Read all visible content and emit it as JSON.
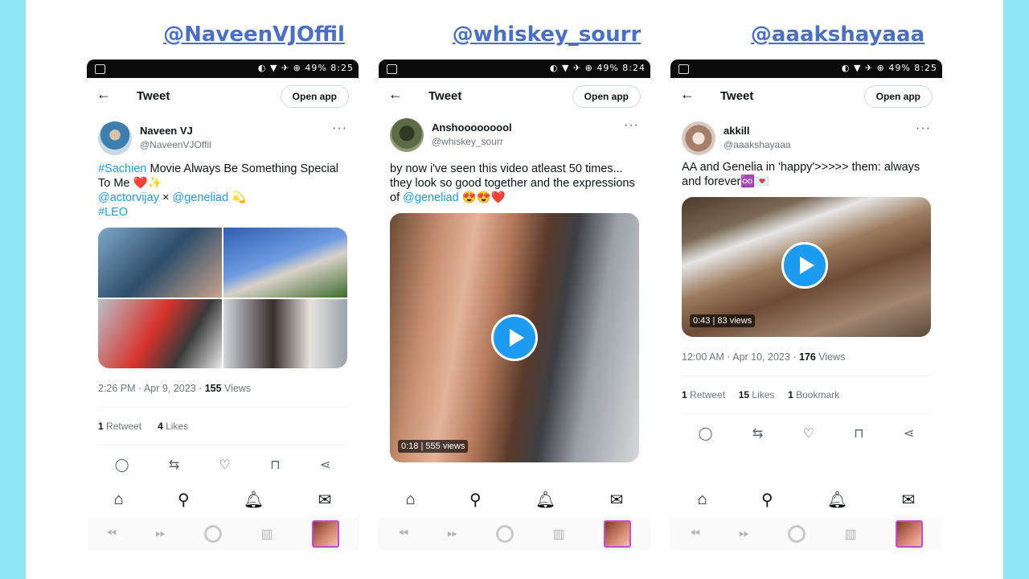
{
  "handles": [
    "@NaveenVJOffil",
    "@whiskey_sourr",
    "@aaakshayaaa"
  ],
  "status": {
    "right_text": "◐ ▼ ✈ ⊕ 49% 8:25",
    "right_text_2": "◐ ▼ ✈ ⊕ 49% 8:24"
  },
  "common": {
    "back": "←",
    "title": "Tweet",
    "open_app": "Open app",
    "more": "···"
  },
  "tweets": [
    {
      "name": "Naveen VJ",
      "handle": "@NaveenVJOffil",
      "text_link1": "#Sachien",
      "text_1": " Movie Always Be Something Special To Me ❤️✨",
      "text_link2": "@actorvijay",
      "text_2": " × ",
      "text_link3": "@geneliad",
      "text_3": " 💫",
      "text_link4": "#LEO",
      "time": "2:26 PM · Apr 9, 2023 · ",
      "views_count": "155",
      "views_label": " Views",
      "retweets": "1",
      "retweets_label": " Retweet",
      "likes": "4",
      "likes_label": " Likes"
    },
    {
      "name": "Anshooooooool",
      "handle": "@whiskey_sourr",
      "text": "by now i've seen this video atleast 50 times... they look so good together and the expressions of ",
      "text_link": "@geneliad",
      "text_end": " 😍😍❤️",
      "video_time": "0:18",
      "video_views": "555 views"
    },
    {
      "name": "akkill",
      "handle": "@aaakshayaaa",
      "text": "AA and Genelia in 'happy'>>>>> them: always and forever♾️💌",
      "video_time": "0:43",
      "video_views": "83 views",
      "time": "12:00 AM · Apr 10, 2023 · ",
      "views_count": "176",
      "views_label": " Views",
      "retweets": "1",
      "retweets_label": " Retweet",
      "likes": "15",
      "likes_label": " Likes",
      "bookmarks": "1",
      "bookmarks_label": " Bookmark"
    }
  ],
  "actions": {
    "reply": "◯",
    "retweet": "⇆",
    "like": "♡",
    "bookmark": "⊓",
    "share": "⋖"
  },
  "icons": {
    "home": "home-icon",
    "search": "search-icon",
    "bell": "bell-icon",
    "mail": "mail-icon"
  },
  "colors": {
    "page_bg": "#8ee6f7",
    "handle_color": "#4a6fc7",
    "link": "#1d9bf0"
  }
}
